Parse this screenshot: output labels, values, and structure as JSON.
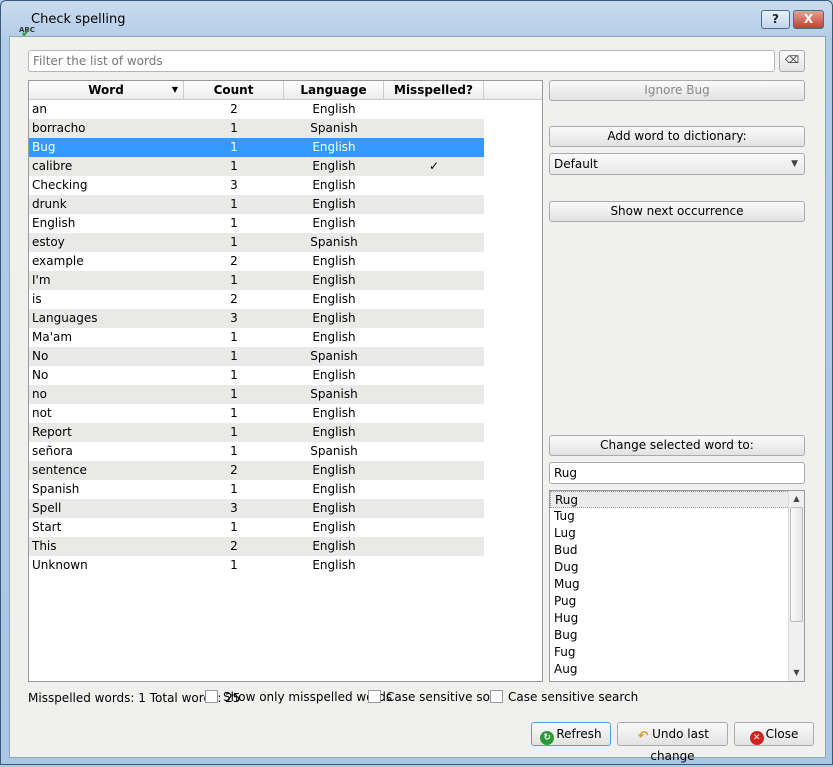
{
  "window": {
    "title": "Check spelling",
    "help": "?",
    "close": "X"
  },
  "filter": {
    "placeholder": "Filter the list of words",
    "clear_icon": "clear-icon"
  },
  "table": {
    "headers": [
      "Word",
      "Count",
      "Language",
      "Misspelled?"
    ],
    "rows": [
      [
        "an",
        "2",
        "English",
        ""
      ],
      [
        "borracho",
        "1",
        "Spanish",
        ""
      ],
      [
        "Bug",
        "1",
        "English",
        ""
      ],
      [
        "calibre",
        "1",
        "English",
        "✓"
      ],
      [
        "Checking",
        "3",
        "English",
        ""
      ],
      [
        "drunk",
        "1",
        "English",
        ""
      ],
      [
        "English",
        "1",
        "English",
        ""
      ],
      [
        "estoy",
        "1",
        "Spanish",
        ""
      ],
      [
        "example",
        "2",
        "English",
        ""
      ],
      [
        "I'm",
        "1",
        "English",
        ""
      ],
      [
        "is",
        "2",
        "English",
        ""
      ],
      [
        "Languages",
        "3",
        "English",
        ""
      ],
      [
        "Ma'am",
        "1",
        "English",
        ""
      ],
      [
        "No",
        "1",
        "Spanish",
        ""
      ],
      [
        "No",
        "1",
        "English",
        ""
      ],
      [
        "no",
        "1",
        "Spanish",
        ""
      ],
      [
        "not",
        "1",
        "English",
        ""
      ],
      [
        "Report",
        "1",
        "English",
        ""
      ],
      [
        "señora",
        "1",
        "Spanish",
        ""
      ],
      [
        "sentence",
        "2",
        "English",
        ""
      ],
      [
        "Spanish",
        "1",
        "English",
        ""
      ],
      [
        "Spell",
        "3",
        "English",
        ""
      ],
      [
        "Start",
        "1",
        "English",
        ""
      ],
      [
        "This",
        "2",
        "English",
        ""
      ],
      [
        "Unknown",
        "1",
        "English",
        ""
      ]
    ],
    "selected_index": 2
  },
  "right": {
    "ignore": "Ignore Bug",
    "add": "Add word to dictionary:",
    "dictionary": "Default",
    "next": "Show next occurrence",
    "change": "Change selected word to:",
    "replacement": "Rug",
    "suggestions": [
      "Rug",
      "Tug",
      "Lug",
      "Bud",
      "Dug",
      "Mug",
      "Pug",
      "Hug",
      "Bug",
      "Fug",
      "Aug"
    ]
  },
  "footer": {
    "status": "Misspelled words: 1 Total words: 25",
    "show_only": "Show only misspelled words",
    "case_sort": "Case sensitive sort",
    "case_search": "Case sensitive search",
    "refresh": "Refresh",
    "undo": "Undo last change",
    "close": "Close"
  }
}
